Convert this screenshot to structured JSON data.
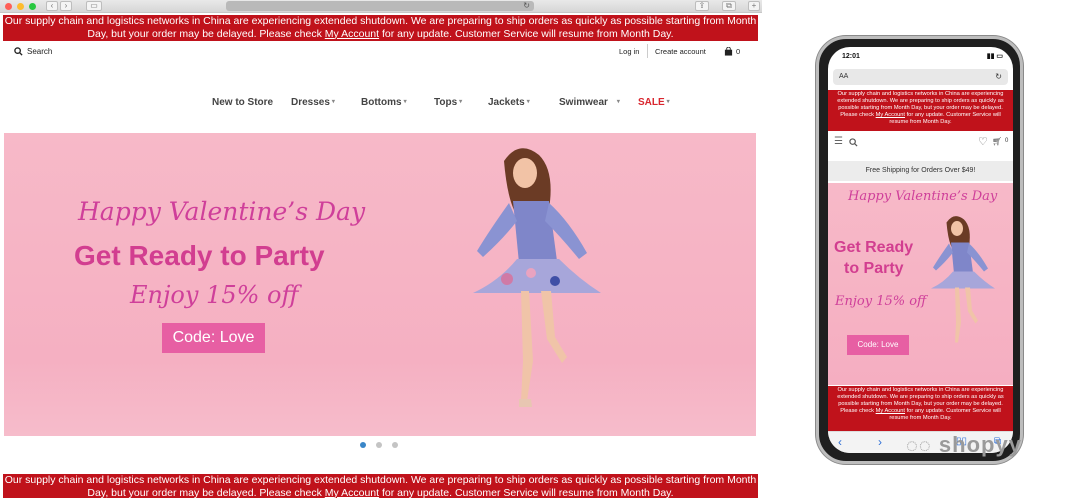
{
  "banner": {
    "text_before": "Our supply chain and logistics networks in China are experiencing extended shutdown. We are preparing to ship orders as quickly as possible starting from Month Day, but your order may be delayed. Please check ",
    "link": "My Account",
    "text_after": " for any update. Customer Service will resume from Month Day."
  },
  "header": {
    "search_label": "Search",
    "login": "Log in",
    "create_account": "Create account",
    "cart_count": "0"
  },
  "nav": {
    "items": [
      "New to Store",
      "Dresses",
      "Bottoms",
      "Tops",
      "Jackets",
      "Swimwear",
      "SALE"
    ]
  },
  "hero": {
    "line1": "Happy Valentine’s Day",
    "headline": "Get Ready to Party",
    "offer": "Enjoy 15% off",
    "code_button": "Code: Love"
  },
  "carousel": {
    "slides": 3,
    "active": 0
  },
  "phone": {
    "time": "12:01",
    "url_text": "AA",
    "free_shipping": "Free Shipping for Orders Over $49!",
    "headline_line1": "Get Ready",
    "headline_line2": "to Party",
    "cart_count": "0"
  },
  "watermark": "shopyy",
  "colors": {
    "banner_red": "#c0121b",
    "hero_pink": "#f7b9c8",
    "accent_magenta": "#d23e90",
    "button_pink": "#e75fa3",
    "sale_red": "#d9262e"
  }
}
